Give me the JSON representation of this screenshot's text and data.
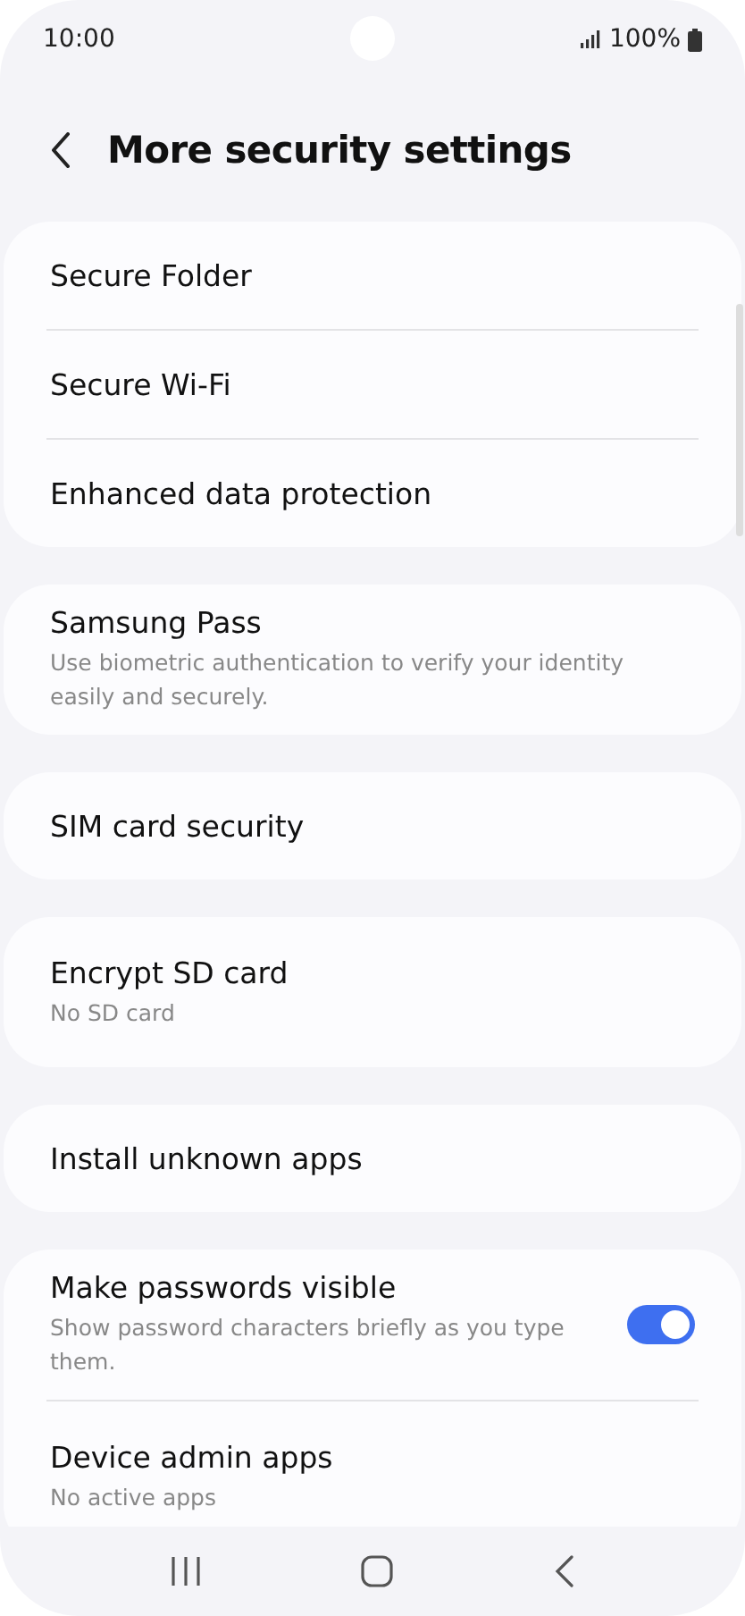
{
  "status_bar": {
    "time": "10:00",
    "battery": "100%"
  },
  "header": {
    "title": "More security settings"
  },
  "groups": [
    {
      "items": [
        {
          "kind": "plain",
          "title": "Secure Folder"
        },
        {
          "kind": "plain",
          "title": "Secure Wi-Fi"
        },
        {
          "kind": "plain",
          "title": "Enhanced data protection"
        }
      ]
    },
    {
      "items": [
        {
          "kind": "plain",
          "title": "Samsung Pass",
          "subtitle": "Use biometric authentication to verify your identity easily and securely."
        }
      ]
    },
    {
      "items": [
        {
          "kind": "plain",
          "title": "SIM card security"
        }
      ]
    },
    {
      "items": [
        {
          "kind": "plain",
          "title": "Encrypt SD card",
          "subtitle": "No SD card"
        }
      ]
    },
    {
      "items": [
        {
          "kind": "plain",
          "title": "Install unknown apps"
        }
      ]
    },
    {
      "items": [
        {
          "kind": "toggle",
          "title": "Make passwords visible",
          "subtitle": "Show password characters briefly as you type them.",
          "on": true
        },
        {
          "kind": "plain",
          "title": "Device admin apps",
          "subtitle": "No active apps"
        }
      ]
    }
  ]
}
